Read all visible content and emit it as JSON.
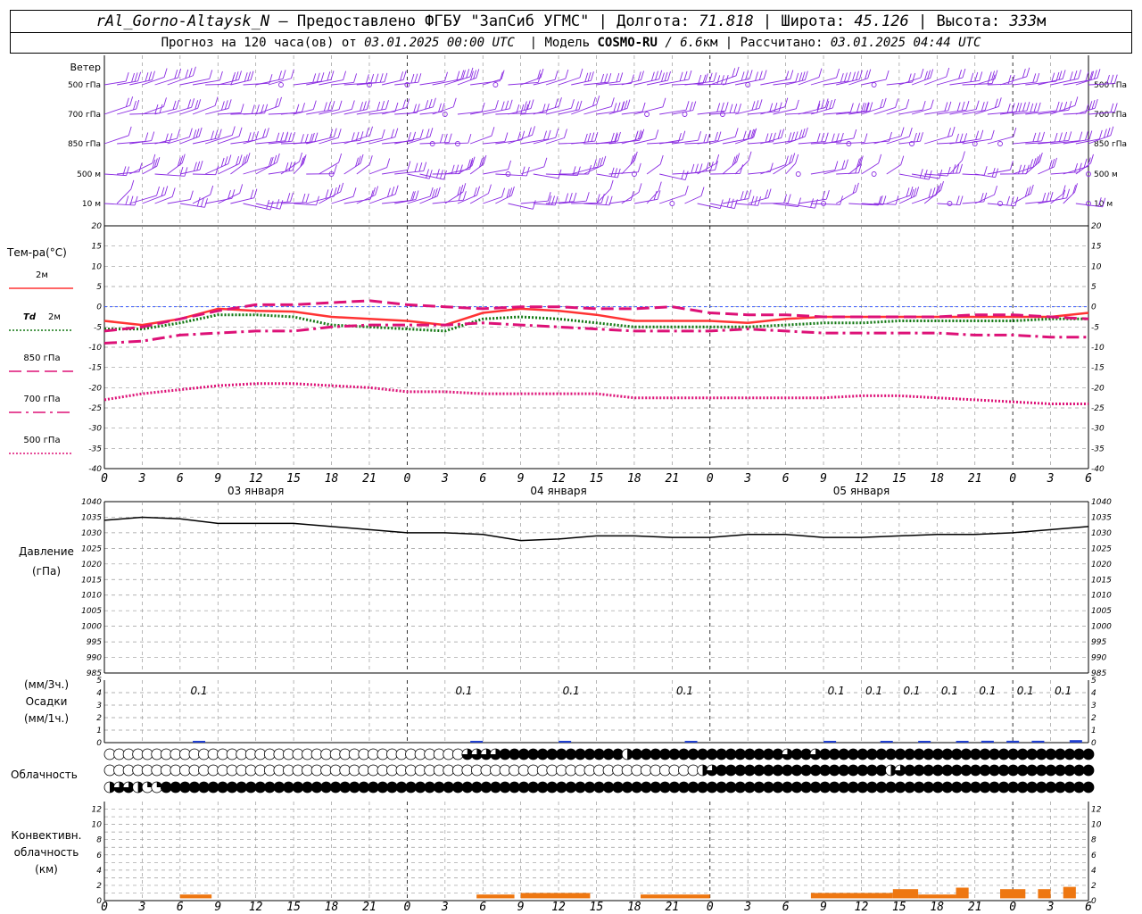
{
  "header": {
    "station": "rAl_Gorno-Altaysk_N",
    "dash": "–",
    "provider": "Предоставлено ФГБУ \"ЗапСиб УГМС\"",
    "lon_label": "Долгота:",
    "lon_value": "71.818",
    "lat_label": "Широта:",
    "lat_value": "45.126",
    "alt_label": "Высота:",
    "alt_value": "333",
    "alt_unit": "м",
    "forecast_prefix": "Прогноз на 120 часа(ов) от",
    "forecast_time": "03.01.2025 00:00 UTC",
    "model_label": "Модель",
    "model_name": "COSMO-RU",
    "model_res": "/ 6.6",
    "model_res_unit": "км",
    "computed_label": "Рассчитано:",
    "computed_time": "03.01.2025 04:44 UTC"
  },
  "x_axis": {
    "hour_ticks": [
      "0",
      "3",
      "6",
      "9",
      "12",
      "15",
      "18",
      "21",
      "0",
      "3",
      "6",
      "9",
      "12",
      "15",
      "18",
      "21",
      "0",
      "3",
      "6",
      "9",
      "12",
      "15",
      "18",
      "21",
      "0",
      "3",
      "6"
    ],
    "day_labels": [
      "03 января",
      "04 января",
      "05 января"
    ]
  },
  "panels": {
    "wind": {
      "title": "Ветер",
      "levels": [
        "500 гПа",
        "700 гПа",
        "850 гПа",
        "500 м",
        "10 м"
      ]
    },
    "temperature": {
      "title": "Тем-ра(°C)",
      "legend": [
        {
          "name": "2м",
          "color": "#ff3333",
          "style": "solid"
        },
        {
          "name": "Td 2м",
          "color": "#117711",
          "style": "dotted"
        },
        {
          "name": "850 гПа",
          "color": "#dd1177",
          "style": "long-dash"
        },
        {
          "name": "700 гПа",
          "color": "#dd1177",
          "style": "dash-dot"
        },
        {
          "name": "500 гПа",
          "color": "#dd1177",
          "style": "dotted"
        }
      ],
      "yticks": [
        "20",
        "15",
        "10",
        "5",
        "0",
        "-5",
        "-10",
        "-15",
        "-20",
        "-25",
        "-30",
        "-35",
        "-40"
      ]
    },
    "pressure": {
      "title": "Давление",
      "unit": "(гПа)",
      "yticks": [
        "1040",
        "1035",
        "1030",
        "1025",
        "1020",
        "1015",
        "1010",
        "1005",
        "1000",
        "995",
        "990",
        "985"
      ]
    },
    "precip": {
      "title_top": "(мм/3ч.)",
      "title_mid": "Осадки",
      "title_bot": "(мм/1ч.)",
      "yticks": [
        "5",
        "4",
        "3",
        "2",
        "1",
        "0"
      ]
    },
    "clouds": {
      "title": "Облачность"
    },
    "convective": {
      "title_1": "Конвективн.",
      "title_2": "облачность",
      "title_3": "(км)",
      "yticks": [
        "12",
        "10",
        "8",
        "6",
        "4",
        "2",
        "0"
      ]
    }
  },
  "chart_data": [
    {
      "type": "line",
      "title": "Тем-ра(°C)",
      "ylim": [
        -40,
        20
      ],
      "x_hours": [
        0,
        3,
        6,
        9,
        12,
        15,
        18,
        21,
        24,
        27,
        30,
        33,
        36,
        39,
        42,
        45,
        48,
        51,
        54,
        57,
        60,
        63,
        66,
        69,
        72,
        75,
        78
      ],
      "series": [
        {
          "name": "2м",
          "values": [
            -3.5,
            -4.5,
            -3,
            -0.5,
            -1,
            -1.2,
            -2.5,
            -3,
            -3.5,
            -4.5,
            -1.5,
            -0.5,
            -1,
            -2,
            -3.5,
            -3.5,
            -3.5,
            -4,
            -3,
            -2.5,
            -2.5,
            -2.5,
            -2.5,
            -2.5,
            -2.5,
            -2.5,
            -1.5
          ]
        },
        {
          "name": "Td 2м",
          "values": [
            -5.5,
            -5.5,
            -4,
            -2,
            -2,
            -2.5,
            -4.5,
            -5,
            -5.5,
            -6,
            -3,
            -2.5,
            -3,
            -4,
            -5,
            -5,
            -5,
            -5,
            -4.5,
            -4,
            -4,
            -3.5,
            -3.5,
            -3.5,
            -3.5,
            -3,
            -3
          ]
        },
        {
          "name": "850 гПа",
          "values": [
            -6,
            -5,
            -3,
            -1,
            0.5,
            0.5,
            1,
            1.5,
            0.5,
            0,
            -0.5,
            0,
            0,
            -0.5,
            -0.5,
            0,
            -1.5,
            -2,
            -2,
            -2.5,
            -2.5,
            -2.5,
            -2.5,
            -2,
            -2,
            -2.5,
            -3
          ]
        },
        {
          "name": "700 гПа",
          "values": [
            -9,
            -8.5,
            -7,
            -6.5,
            -6,
            -6,
            -5,
            -4.5,
            -4.5,
            -4.5,
            -4,
            -4.5,
            -5,
            -5.5,
            -6,
            -6,
            -6,
            -5.5,
            -6,
            -6.5,
            -6.5,
            -6.5,
            -6.5,
            -7,
            -7,
            -7.5,
            -7.5
          ]
        },
        {
          "name": "500 гПа",
          "values": [
            -23,
            -21.5,
            -20.5,
            -19.5,
            -19,
            -19,
            -19.5,
            -20,
            -21,
            -21,
            -21.5,
            -21.5,
            -21.5,
            -21.5,
            -22.5,
            -22.5,
            -22.5,
            -22.5,
            -22.5,
            -22.5,
            -22,
            -22,
            -22.5,
            -23,
            -23.5,
            -24,
            -24
          ]
        }
      ]
    },
    {
      "type": "line",
      "title": "Давление",
      "ylim": [
        985,
        1040
      ],
      "x_hours": [
        0,
        3,
        6,
        9,
        12,
        15,
        18,
        21,
        24,
        27,
        30,
        33,
        36,
        39,
        42,
        45,
        48,
        51,
        54,
        57,
        60,
        63,
        66,
        69,
        72,
        75,
        78
      ],
      "series": [
        {
          "name": "Давление",
          "values": [
            1034,
            1035,
            1034.5,
            1033,
            1033,
            1033,
            1032,
            1031,
            1030,
            1030,
            1029.5,
            1027.5,
            1028,
            1029,
            1029,
            1028.5,
            1028.5,
            1029.5,
            1029.5,
            1028.5,
            1028.5,
            1029,
            1029.5,
            1029.5,
            1030,
            1031,
            1032
          ]
        }
      ]
    },
    {
      "type": "bar",
      "title": "Осадки",
      "ylim": [
        0,
        5
      ],
      "annotations": [
        {
          "hour": 7.5,
          "text": "0.1"
        },
        {
          "hour": 28.5,
          "text": "0.1"
        },
        {
          "hour": 37,
          "text": "0.1"
        },
        {
          "hour": 46,
          "text": "0.1"
        },
        {
          "hour": 58,
          "text": "0.1"
        },
        {
          "hour": 61,
          "text": "0.1"
        },
        {
          "hour": 64,
          "text": "0.1"
        },
        {
          "hour": 67,
          "text": "0.1"
        },
        {
          "hour": 70,
          "text": "0.1"
        },
        {
          "hour": 73,
          "text": "0.1"
        },
        {
          "hour": 76,
          "text": "0.1"
        }
      ],
      "bars": [
        {
          "hour": 7.5,
          "value": 0.1
        },
        {
          "hour": 29.5,
          "value": 0.1
        },
        {
          "hour": 36.5,
          "value": 0.1
        },
        {
          "hour": 46.5,
          "value": 0.1
        },
        {
          "hour": 57.5,
          "value": 0.1
        },
        {
          "hour": 62,
          "value": 0.1
        },
        {
          "hour": 65,
          "value": 0.1
        },
        {
          "hour": 68,
          "value": 0.1
        },
        {
          "hour": 70,
          "value": 0.15
        },
        {
          "hour": 72,
          "value": 0.15
        },
        {
          "hour": 74,
          "value": 0.15
        },
        {
          "hour": 77,
          "value": 0.2
        }
      ]
    },
    {
      "type": "bar",
      "title": "Конвективн. облачность",
      "ylim": [
        0,
        13
      ],
      "bars": [
        {
          "hour_start": 6,
          "hour_end": 8.5,
          "value": 0.8
        },
        {
          "hour_start": 29.5,
          "hour_end": 32.5,
          "value": 0.8
        },
        {
          "hour_start": 33,
          "hour_end": 38.5,
          "value": 1
        },
        {
          "hour_start": 42.5,
          "hour_end": 48,
          "value": 0.8
        },
        {
          "hour_start": 56,
          "hour_end": 62.5,
          "value": 1
        },
        {
          "hour_start": 62.5,
          "hour_end": 64.5,
          "value": 1.5
        },
        {
          "hour_start": 64.5,
          "hour_end": 67.5,
          "value": 0.8
        },
        {
          "hour_start": 67.5,
          "hour_end": 68.5,
          "value": 1.7
        },
        {
          "hour_start": 71,
          "hour_end": 73,
          "value": 1.5
        },
        {
          "hour_start": 74,
          "hour_end": 75,
          "value": 1.5
        },
        {
          "hour_start": 76,
          "hour_end": 77,
          "value": 1.8
        }
      ]
    }
  ],
  "clouds_data": {
    "rows": [
      "000000000000000000000000000000000000003333444444444444424444444444444444344344444444444444444444444444444",
      "000000000000000000000000000000000000000000000000000000000000000234444444444444444442344444444444444444444",
      "233211444444444444444444444444444444444444444444444444444444444444444444444444444444444444444444444444444"
    ]
  },
  "colors": {
    "wind": "#8a2be2",
    "pressure": "#000000",
    "precip": "#1f3fd0",
    "convective": "#ee7711",
    "grid": "#999999"
  }
}
